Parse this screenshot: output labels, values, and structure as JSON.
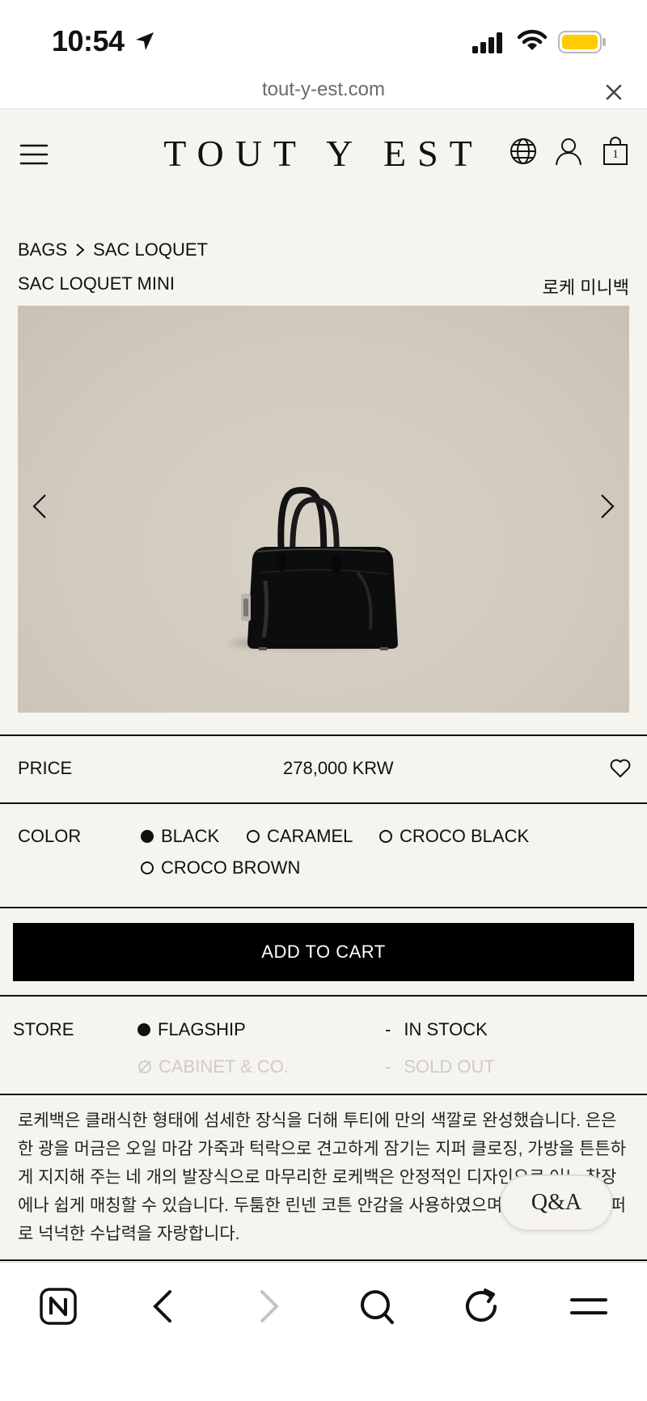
{
  "status_bar": {
    "time": "10:54"
  },
  "browser": {
    "url": "tout-y-est.com"
  },
  "header": {
    "logo": "TOUT Y EST",
    "cart_count": "1"
  },
  "breadcrumb": {
    "parent": "BAGS",
    "current": "SAC LOQUET"
  },
  "product": {
    "title": "SAC LOQUET MINI",
    "title_ko": "로케 미니백",
    "price_label": "PRICE",
    "price": "278,000 KRW",
    "color_label": "COLOR",
    "colors": [
      {
        "label": "BLACK",
        "selected": true
      },
      {
        "label": "CARAMEL",
        "selected": false
      },
      {
        "label": "CROCO BLACK",
        "selected": false
      },
      {
        "label": "CROCO BROWN",
        "selected": false
      }
    ],
    "add_to_cart": "ADD TO CART",
    "store_label": "STORE",
    "stores": [
      {
        "name": "FLAGSHIP",
        "status": "IN STOCK",
        "available": true
      },
      {
        "name": "CABINET & CO.",
        "status": "SOLD OUT",
        "available": false
      }
    ],
    "description": "로케백은 클래식한 형태에 섬세한 장식을 더해 투티에 만의 색깔로 완성했습니다. 은은한 광을 머금은 오일 마감 가죽과 턱락으로 견고하게 잠기는 지퍼 클로징, 가방을 튼튼하게 지지해 주는 네 개의 발장식으로 마무리한 로케백은 안정적인 디자인으로 어느 착장에나 쉽게 매칭할 수 있습니다. 두툼한 린넨 코튼 안감을 사용하였으며 넓게 열리는 지퍼로 넉넉한 수납력을 자랑합니다."
  },
  "qa_button": "Q&A",
  "colors": {
    "background": "#f6f4ee",
    "button": "#000000",
    "muted": "#cfccc5",
    "battery": "#ffcc00"
  }
}
